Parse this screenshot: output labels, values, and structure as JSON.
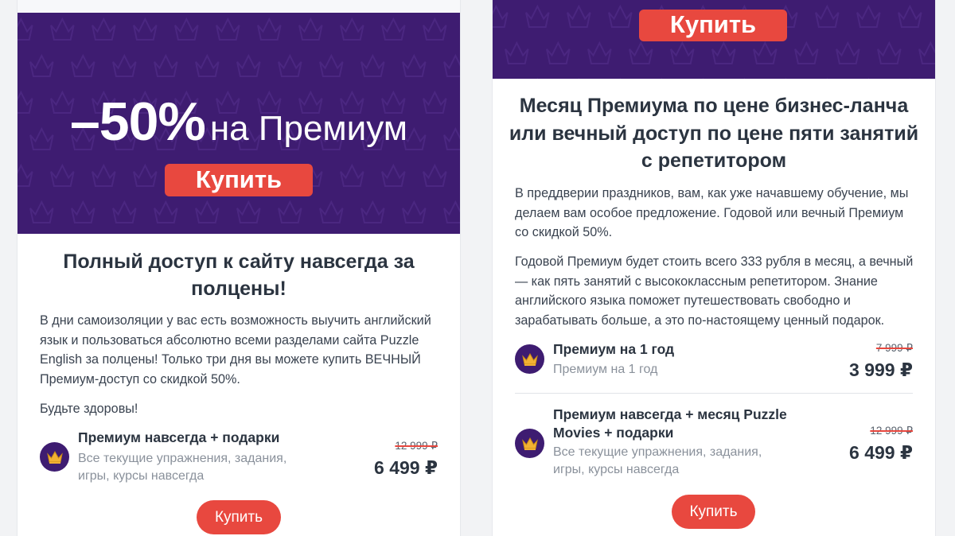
{
  "colors": {
    "banner_bg": "#3e1c71",
    "accent": "#e8483f",
    "crown_gold": "#f2b233",
    "text": "#2b3440",
    "muted": "#8a919b"
  },
  "left_card": {
    "banner": {
      "discount": "–50%",
      "headline_rest": "на Премиум",
      "buy_label": "Купить"
    },
    "title": "Полный доступ к сайту навсегда за полцены!",
    "paragraphs": [
      "В дни самоизоляции у вас есть возможность выучить английский язык и пользоваться абсолютно всеми разделами сайта Puzzle English за полцены! Только три дня вы можете купить ВЕЧНЫЙ Премиум-доступ со скидкой 50%.",
      "Будьте здоровы!"
    ],
    "offer": {
      "icon": "crown-icon",
      "name": "Премиум навсегда + подарки",
      "description": "Все текущие упражнения, задания, игры, курсы навсегда",
      "old_price": "12 999 ₽",
      "price": "6 499 ₽"
    },
    "buy_label": "Купить"
  },
  "right_card": {
    "banner": {
      "buy_label": "Купить"
    },
    "title": "Месяц Премиума по цене бизнес-ланча или вечный доступ по цене пяти занятий с репетитором",
    "paragraphs": [
      "В преддверии праздников, вам, как уже начавшему обучение, мы делаем вам особое предложение. Годовой или вечный Премиум со скидкой 50%.",
      "Годовой Премиум будет стоить всего 333 рубля в месяц, а вечный — как пять занятий с высококлассным репетитором. Знание английского языка поможет путешествовать свободно и зарабатывать больше, а это по-настоящему ценный подарок."
    ],
    "offers": [
      {
        "icon": "crown-icon",
        "name": "Премиум на 1 год",
        "description": "Премиум на 1 год",
        "old_price": "7 999 ₽",
        "price": "3 999 ₽"
      },
      {
        "icon": "crown-icon",
        "name": "Премиум навсегда + месяц Puzzle Movies + подарки",
        "description": "Все текущие упражнения, задания, игры, курсы навсегда",
        "old_price": "12 999 ₽",
        "price": "6 499 ₽"
      }
    ],
    "buy_label": "Купить"
  }
}
